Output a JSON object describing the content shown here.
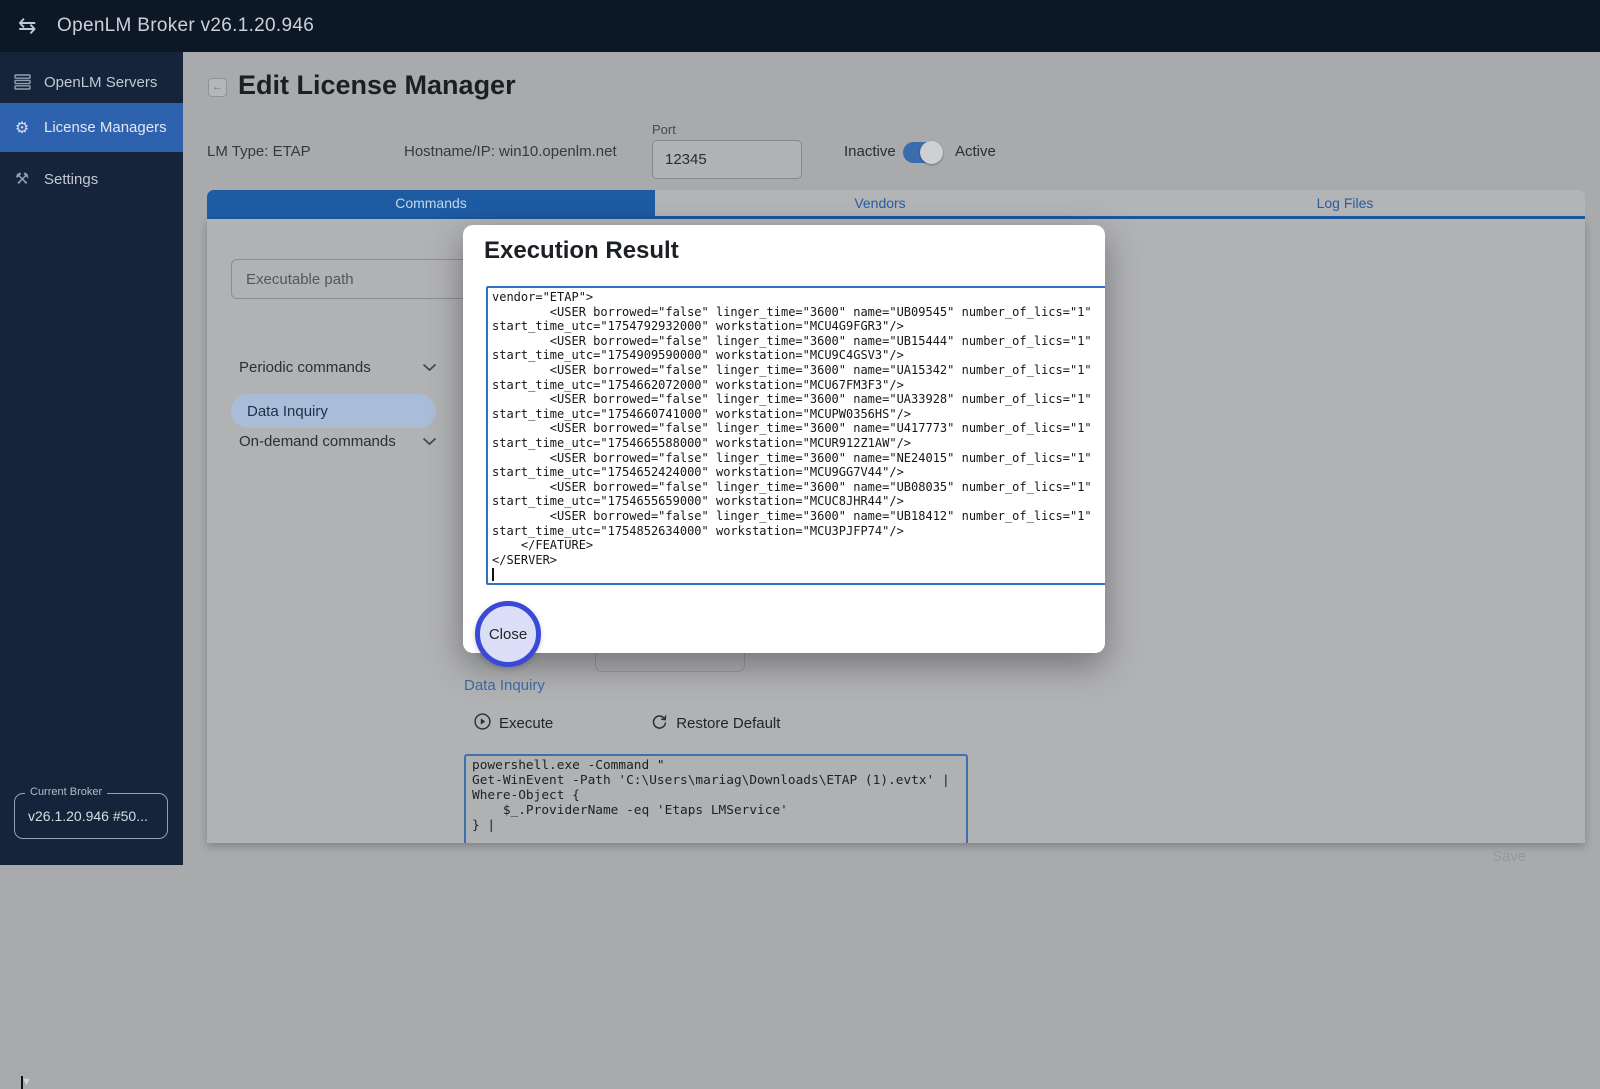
{
  "app": {
    "title": "OpenLM Broker v26.1.20.946"
  },
  "sidebar": {
    "items": [
      {
        "label": "OpenLM Servers"
      },
      {
        "label": "License Managers"
      },
      {
        "label": "Settings"
      }
    ],
    "current_broker": {
      "label": "Current Broker",
      "value": "v26.1.20.946 #50..."
    }
  },
  "header": {
    "title": "Edit License Manager",
    "lm_type": "LM Type: ETAP",
    "hostname": "Hostname/IP: win10.openlm.net",
    "port_label": "Port",
    "port_value": "12345",
    "toggle": {
      "left_label": "Inactive",
      "right_label": "Active",
      "state": "active"
    }
  },
  "tabs": [
    {
      "label": "Commands",
      "active": true
    },
    {
      "label": "Vendors",
      "active": false
    },
    {
      "label": "Log Files",
      "active": false
    }
  ],
  "commands_panel": {
    "executable_path_placeholder": "Executable path",
    "groups": [
      {
        "label": "Periodic commands"
      },
      {
        "label": "On-demand commands"
      }
    ],
    "selected_command": "Data Inquiry"
  },
  "command_detail": {
    "heading": "Data Inquiry",
    "execute_label": "Execute",
    "restore_label": "Restore Default",
    "command_lines": [
      "powershell.exe -Command \"",
      "Get-WinEvent -Path 'C:\\Users\\mariag\\Downloads\\ETAP (1).evtx' |",
      "Where-Object {",
      "    $_.ProviderName -eq 'Etaps LMService'",
      "} |"
    ]
  },
  "modal": {
    "title": "Execution Result",
    "close_label": "Close",
    "xml_lines": [
      "vendor=\"ETAP\">",
      "        <USER borrowed=\"false\" linger_time=\"3600\" name=\"UB09545\" number_of_lics=\"1\"",
      "start_time_utc=\"1754792932000\" workstation=\"MCU4G9FGR3\"/>",
      "        <USER borrowed=\"false\" linger_time=\"3600\" name=\"UB15444\" number_of_lics=\"1\"",
      "start_time_utc=\"1754909590000\" workstation=\"MCU9C4GSV3\"/>",
      "        <USER borrowed=\"false\" linger_time=\"3600\" name=\"UA15342\" number_of_lics=\"1\"",
      "start_time_utc=\"1754662072000\" workstation=\"MCU67FM3F3\"/>",
      "        <USER borrowed=\"false\" linger_time=\"3600\" name=\"UA33928\" number_of_lics=\"1\"",
      "start_time_utc=\"1754660741000\" workstation=\"MCUPW0356HS\"/>",
      "        <USER borrowed=\"false\" linger_time=\"3600\" name=\"U417773\" number_of_lics=\"1\"",
      "start_time_utc=\"1754665588000\" workstation=\"MCUR912Z1AW\"/>",
      "        <USER borrowed=\"false\" linger_time=\"3600\" name=\"NE24015\" number_of_lics=\"1\"",
      "start_time_utc=\"1754652424000\" workstation=\"MCU9GG7V44\"/>",
      "        <USER borrowed=\"false\" linger_time=\"3600\" name=\"UB08035\" number_of_lics=\"1\"",
      "start_time_utc=\"1754655659000\" workstation=\"MCUC8JHR44\"/>",
      "        <USER borrowed=\"false\" linger_time=\"3600\" name=\"UB18412\" number_of_lics=\"1\"",
      "start_time_utc=\"1754852634000\" workstation=\"MCU3PJFP74\"/>",
      "    </FEATURE>",
      "</SERVER>"
    ]
  },
  "footer": {
    "save_label": "Save"
  },
  "colors": {
    "accent_blue": "#2e61ae",
    "tab_blue": "#1d5ba3",
    "modal_ring_blue": "#3a49d8",
    "textarea_border_blue": "#3071c1",
    "topbar_bg": "#0d1826",
    "sidebar_bg": "#15243a"
  },
  "icons": {
    "topbar": "swap-arrows-icon",
    "glyphs": {
      "swap": "⇆",
      "gear": "⚙",
      "tools": "⚒",
      "back": "←",
      "caret_down": "▼"
    }
  }
}
